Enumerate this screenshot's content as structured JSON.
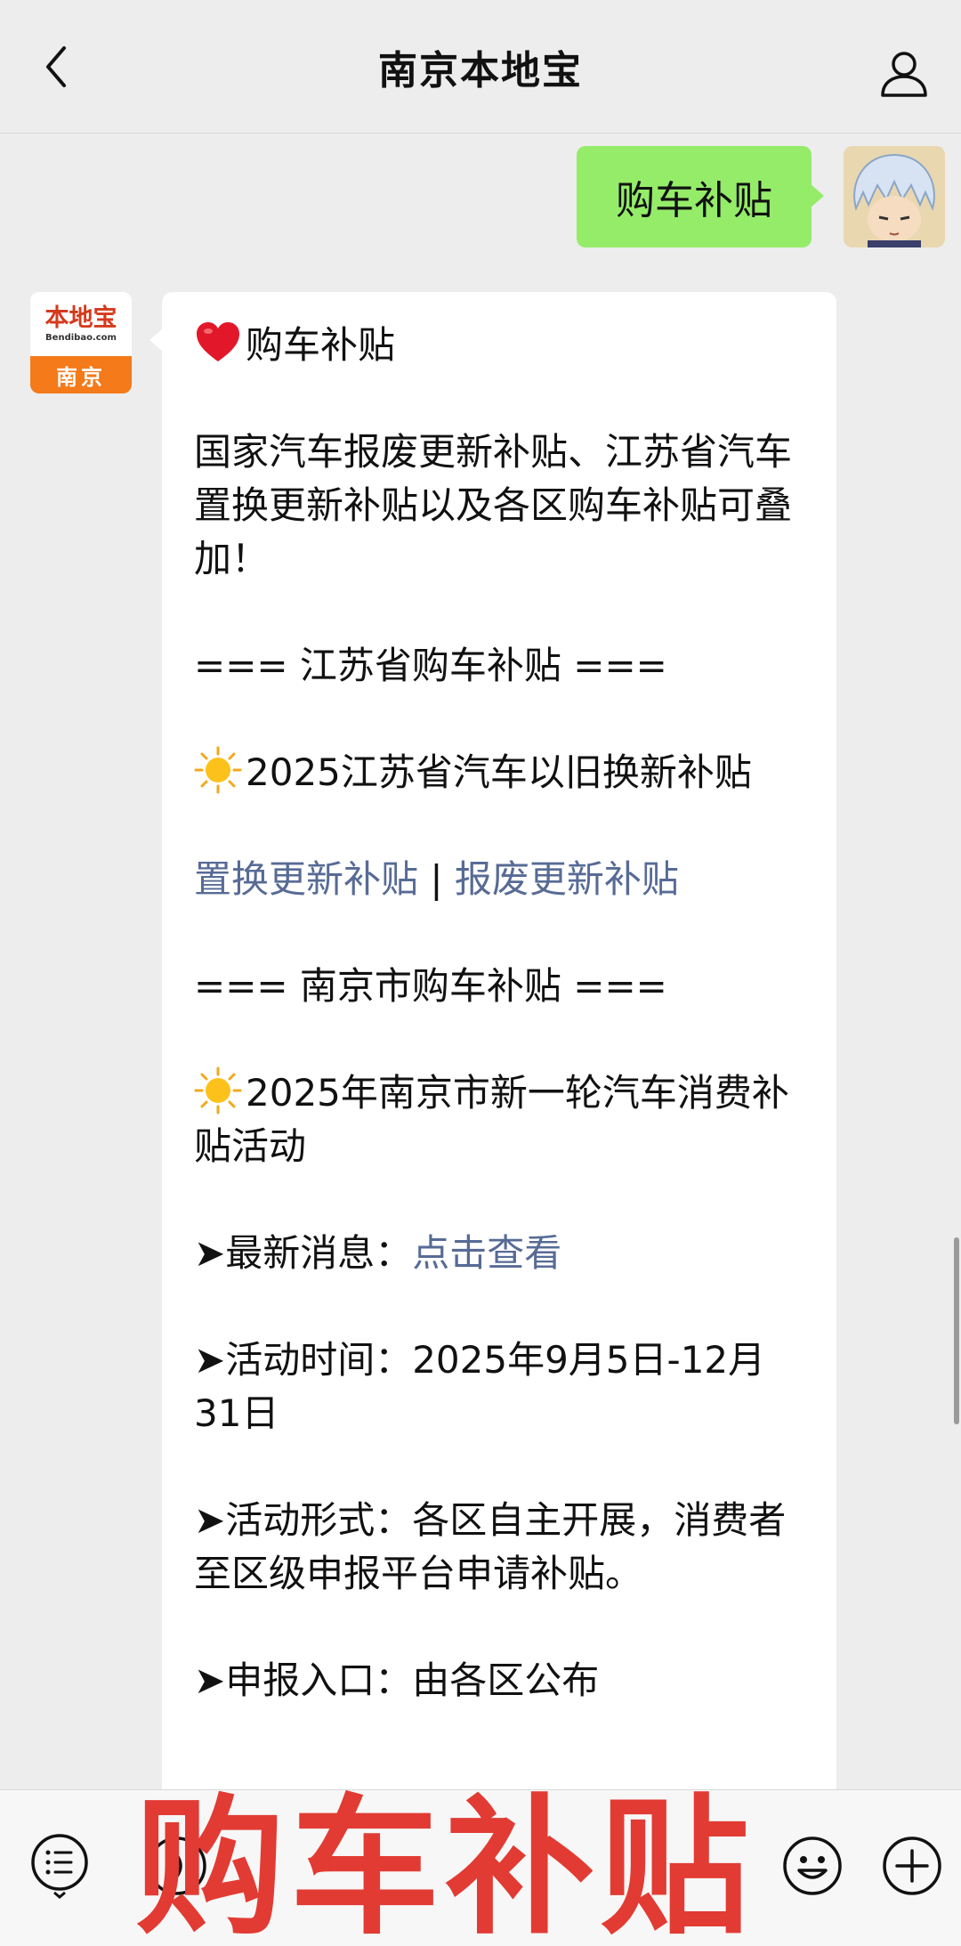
{
  "header": {
    "title": "南京本地宝"
  },
  "chat": {
    "sent_message": "购车补贴",
    "bot_avatar": {
      "logo_text": "本地宝",
      "logo_sub": "Bendibao.com",
      "city": "南京"
    },
    "received": {
      "heading": "购车补贴",
      "intro": "国家汽车报废更新补贴、江苏省汽车置换更新补贴以及各区购车补贴可叠加！",
      "section_jiangsu": "=== 江苏省购车补贴 ===",
      "jiangsu_item": "2025江苏省汽车以旧换新补贴",
      "link_replace": "置换更新补贴",
      "link_separator": " | ",
      "link_scrap": "报废更新补贴",
      "section_nanjing": "=== 南京市购车补贴 ===",
      "nanjing_item": "2025年南京市新一轮汽车消费补贴活动",
      "latest_label": "➤最新消息：",
      "latest_link": "点击查看",
      "time_label": "➤活动时间：",
      "time_value": "2025年9月5日-12月31日",
      "form_label": "➤活动形式：",
      "form_value": "各区自主开展，消费者至区级申报平台申请补贴。",
      "entry_label": "➤申报入口：",
      "entry_value": "由各区公布"
    }
  },
  "overlay": {
    "text": "购车补贴",
    "color": "#e23b33"
  },
  "icons": {
    "back": "chevron-left-icon",
    "profile": "user-icon",
    "menu": "list-icon",
    "voice": "voice-icon",
    "emoji": "smiley-icon",
    "more": "plus-icon",
    "heart": "heart-icon",
    "sun": "sun-icon"
  },
  "colors": {
    "sent_bubble": "#95ec69",
    "link": "#576b95",
    "background": "#ededed"
  }
}
